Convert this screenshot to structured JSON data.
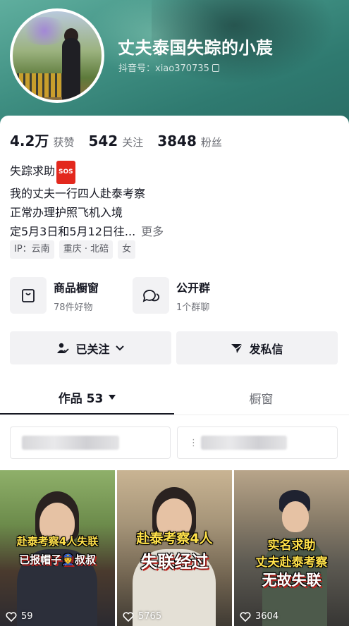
{
  "profile": {
    "nickname": "丈夫泰国失踪的小莀",
    "douyin_id": "抖音号：xiao370735"
  },
  "stats": [
    {
      "value": "4.2万",
      "label": "获赞"
    },
    {
      "value": "542",
      "label": "关注"
    },
    {
      "value": "3848",
      "label": "粉丝"
    }
  ],
  "bio": {
    "line1": "失踪求助",
    "sos_badge": "SOS",
    "line2": "我的丈夫一行四人赴泰考察",
    "line3": "正常办理护照飞机入境",
    "line4": "定5月3日和5月12日往...",
    "more": "更多"
  },
  "tags": [
    "IP：云南",
    "重庆 · 北碚",
    "女"
  ],
  "features": [
    {
      "title": "商品橱窗",
      "subtitle": "78件好物",
      "icon": "shopping-bag-icon"
    },
    {
      "title": "公开群",
      "subtitle": "1个群聊",
      "icon": "chat-bubbles-icon"
    }
  ],
  "actions": {
    "follow_label": "已关注",
    "message_label": "发私信"
  },
  "tabs": {
    "works_label": "作品 53",
    "showcase_label": "橱窗"
  },
  "videos": [
    {
      "caption1": "赴泰考察4人失联",
      "caption2": "已报帽子👮叔叔",
      "likes": "59"
    },
    {
      "caption1": "赴泰考察4人",
      "caption2": "失联经过",
      "likes": "5765"
    },
    {
      "caption1": "实名求助",
      "caption2": "丈夫赴泰考察",
      "caption3": "无故失联",
      "likes": "3604"
    }
  ],
  "colors": {
    "header_accent": "#3f8f82",
    "sos_red": "#e3281d",
    "caption_yellow": "#ffe14a"
  }
}
